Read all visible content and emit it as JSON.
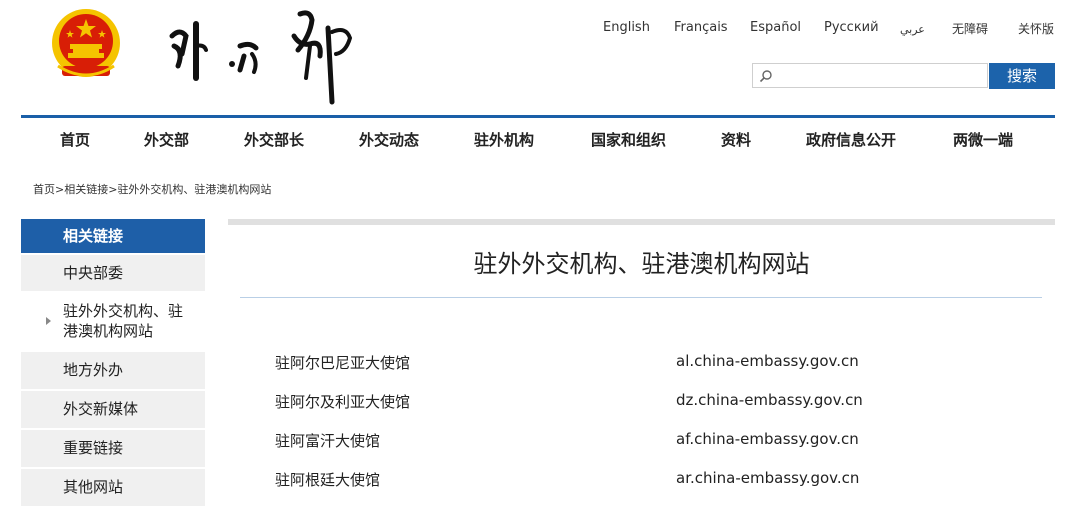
{
  "header": {
    "emblem_icon": "national-emblem-icon",
    "logo_icon": "ministry-calligraphy-logo-icon",
    "languages": [
      "English",
      "Français",
      "Español",
      "Русский",
      "عربي",
      "无障碍",
      "关怀版"
    ],
    "search": {
      "placeholder": "",
      "button_label": "搜索",
      "icon": "search-icon"
    }
  },
  "nav": {
    "items": [
      "首页",
      "外交部",
      "外交部长",
      "外交动态",
      "驻外机构",
      "国家和组织",
      "资料",
      "政府信息公开",
      "两微一端"
    ]
  },
  "breadcrumb": {
    "items": [
      "首页",
      "相关链接",
      "驻外外交机构、驻港澳机构网站"
    ],
    "separator": ">"
  },
  "sidebar": {
    "header": "相关链接",
    "items": [
      "中央部委",
      "驻外外交机构、驻港澳机构网站",
      "地方外办",
      "外交新媒体",
      "重要链接",
      "其他网站"
    ],
    "active_index": 1
  },
  "main": {
    "title": "驻外外交机构、驻港澳机构网站",
    "sites": [
      {
        "name": "驻阿尔巴尼亚大使馆",
        "url": "al.china-embassy.gov.cn"
      },
      {
        "name": "驻阿尔及利亚大使馆",
        "url": "dz.china-embassy.gov.cn"
      },
      {
        "name": "驻阿富汗大使馆",
        "url": "af.china-embassy.gov.cn"
      },
      {
        "name": "驻阿根廷大使馆",
        "url": "ar.china-embassy.gov.cn"
      }
    ]
  },
  "colors": {
    "brand_blue": "#1e5fa8",
    "emblem_red": "#d81e06",
    "emblem_gold": "#f5c400"
  }
}
